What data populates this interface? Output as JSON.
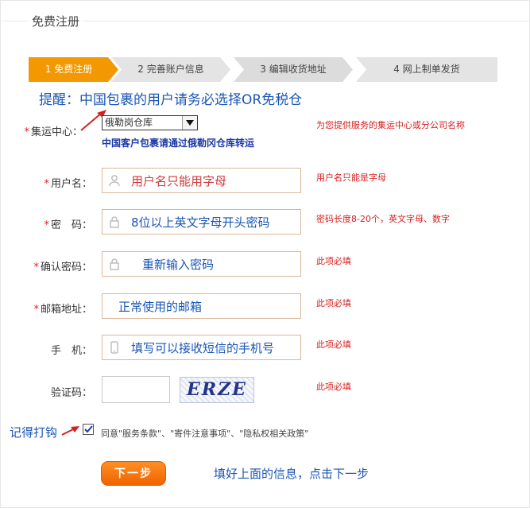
{
  "page": {
    "title": "免费注册"
  },
  "steps": [
    {
      "label": "1 免费注册",
      "active": true
    },
    {
      "label": "2 完善账户信息",
      "active": false
    },
    {
      "label": "3 编辑收货地址",
      "active": false
    },
    {
      "label": "4 网上制单发货",
      "active": false
    }
  ],
  "colors": {
    "active_step": "#f39800",
    "inactive_step": "#e4e4e4",
    "hint_red": "#d42020",
    "annotation_blue": "#1a56b5",
    "button_orange": "#f27300"
  },
  "annotations": {
    "reminder": "提醒：中国包裹的用户请务必选择OR免税仓",
    "remember_check": "记得打钩",
    "bottom": "填好上面的信息，点击下一步"
  },
  "form": {
    "center": {
      "label": "集运中心：",
      "required": "*",
      "selected": "俄勒岗仓库",
      "note": "中国客户包裹请通过俄勒冈仓库转运",
      "hint": "为您提供服务的集运中心或分公司名称"
    },
    "username": {
      "label": "用户名：",
      "required": "*",
      "value": "用户名只能用字母",
      "hint": "用户名只能是字母",
      "icon": "user-icon"
    },
    "password": {
      "label": "密　码：",
      "required": "*",
      "value": "8位以上英文字母开头密码",
      "hint": "密码长度8-20个，英文字母、数字",
      "icon": "lock-icon"
    },
    "confirm": {
      "label": "确认密码：",
      "required": "*",
      "value": "重新输入密码",
      "hint": "此项必填",
      "icon": "lock-icon"
    },
    "email": {
      "label": "邮箱地址：",
      "required": "*",
      "value": "正常使用的邮箱",
      "hint": "此项必填"
    },
    "phone": {
      "label": "手　机：",
      "value": "填写可以接收短信的手机号",
      "hint": "此项必填",
      "icon": "phone-icon"
    },
    "captcha": {
      "label": "验证码：",
      "image_text": "ERZE",
      "hint": "此项必填"
    }
  },
  "agree": {
    "checked": true,
    "text": "同意\"服务条款\"、\"寄件注意事项\"、\"隐私权相关政策\""
  },
  "next_button": {
    "label": "下一步"
  }
}
